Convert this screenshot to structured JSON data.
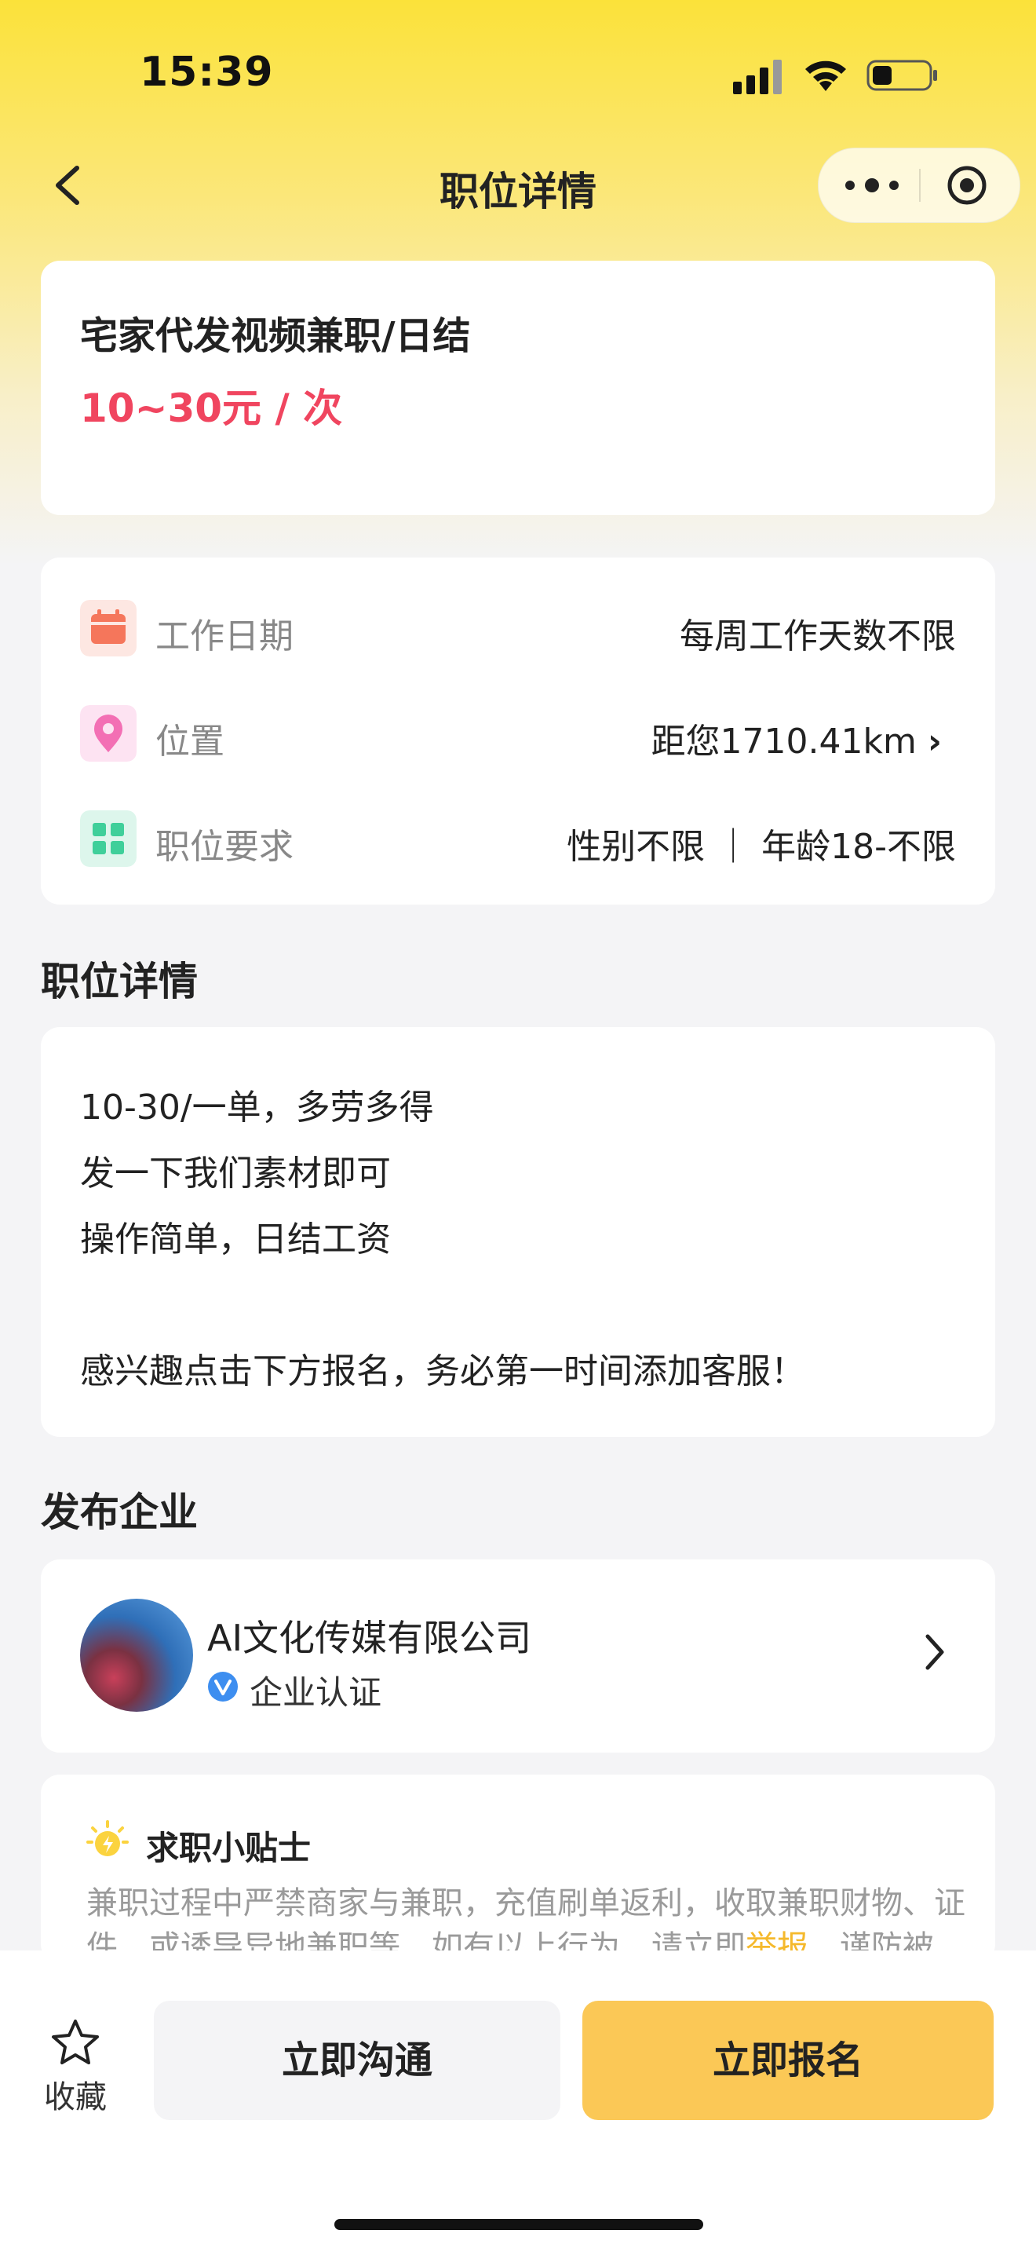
{
  "status": {
    "time": "15:39"
  },
  "nav": {
    "title": "职位详情"
  },
  "job": {
    "title": "宅家代发视频兼职/日结",
    "salary": "10~30元 / 次"
  },
  "info_rows": [
    {
      "icon": "calendar-icon",
      "label": "工作日期",
      "value": "每周工作天数不限"
    },
    {
      "icon": "location-pin-icon",
      "label": "位置",
      "value": "距您1710.41km"
    },
    {
      "icon": "grid-icon",
      "label": "职位要求",
      "value": "性别不限 ｜ 年龄18-不限"
    }
  ],
  "details": {
    "heading": "职位详情",
    "lines": [
      "10-30/一单，多劳多得",
      "发一下我们素材即可",
      "操作简单，日结工资",
      "感兴趣点击下方报名，务必第一时间添加客服！"
    ]
  },
  "company": {
    "heading": "发布企业",
    "name": "AI文化传媒有限公司",
    "verified_label": "企业认证"
  },
  "tips": {
    "title": "求职小贴士",
    "text_before": "兼职过程中严禁商家与兼职，充值刷单返利，收取兼职财物、证件，或诱导异地兼职等，如有以上行为，请立即",
    "report_link": "举报",
    "text_after": "，谨防被骗。"
  },
  "bottom": {
    "favorite_label": "收藏",
    "chat_button": "立即沟通",
    "apply_button": "立即报名"
  },
  "colors": {
    "brand_yellow": "#fbc856",
    "salary_red": "#f0455f",
    "link_yellow": "#f5b92c"
  }
}
